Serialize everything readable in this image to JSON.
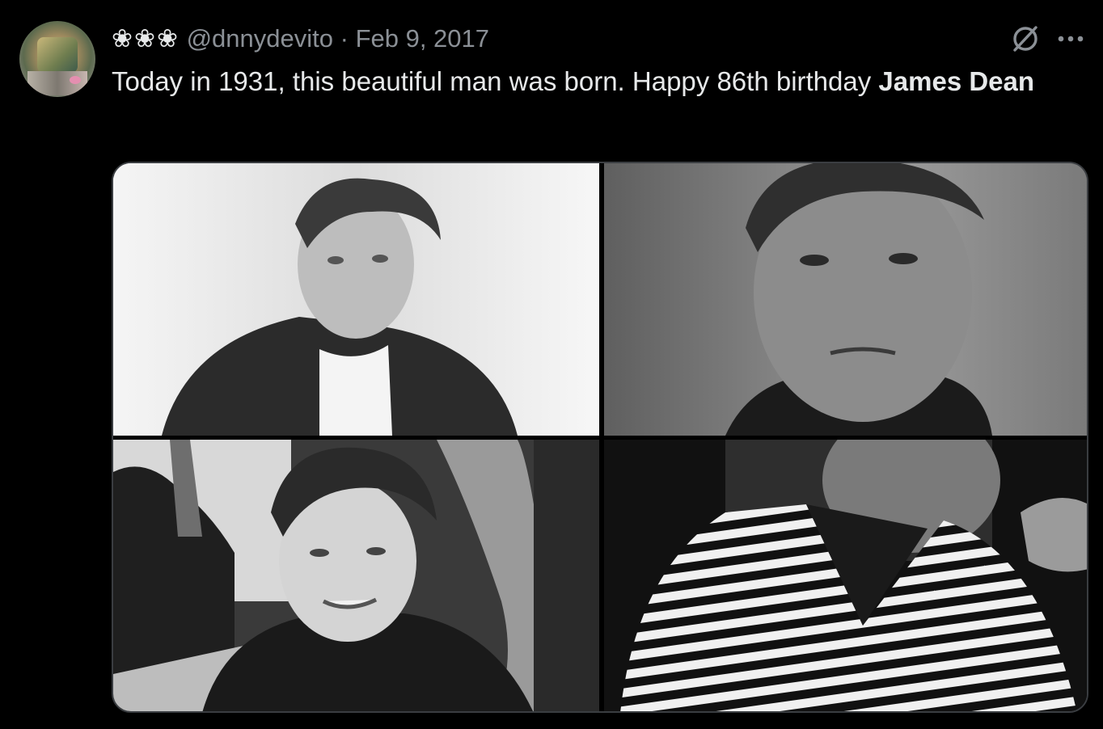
{
  "tweet": {
    "display_name": "❀❀❀",
    "handle": "@dnnydevito",
    "separator": "·",
    "date": "Feb 9, 2017",
    "text_plain": "Today in 1931, this beautiful man was born. Happy 86th birthday ",
    "text_bold": "James Dean"
  },
  "icons": {
    "grok": "grok-slash-icon",
    "more": "more-options-icon"
  },
  "media": {
    "photos": [
      {
        "description_icon": "photo-1"
      },
      {
        "description_icon": "photo-2"
      },
      {
        "description_icon": "photo-3"
      },
      {
        "description_icon": "photo-4"
      }
    ]
  },
  "colors": {
    "background": "#000000",
    "text": "#e7e9ea",
    "muted": "#8b9096",
    "border": "#3a3d41"
  }
}
